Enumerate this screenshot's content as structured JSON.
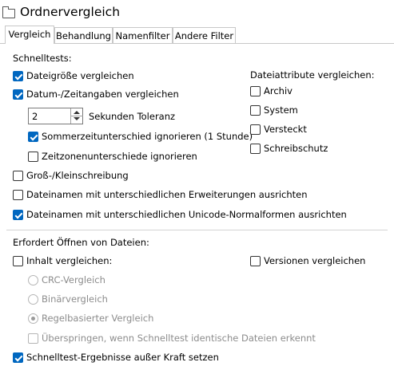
{
  "window": {
    "title": "Ordnervergleich",
    "icon": "folder-icon"
  },
  "tabs": [
    {
      "label": "Vergleich",
      "active": true
    },
    {
      "label": "Behandlung"
    },
    {
      "label": "Namenfilter"
    },
    {
      "label": "Andere Filter"
    }
  ],
  "quick": {
    "heading": "Schnelltests:",
    "size": "Dateigröße vergleichen",
    "datetime": "Datum-/Zeitangaben vergleichen",
    "tolerance_value": "2",
    "tolerance_label": "Sekunden Toleranz",
    "dst": "Sommerzeitunterschied ignorieren (1 Stunde)",
    "timezone": "Zeitzonenunterschiede ignorieren",
    "case": "Groß-/Kleinschreibung",
    "extensions": "Dateinamen mit unterschiedlichen Erweiterungen ausrichten",
    "unicode": "Dateinamen mit unterschiedlichen Unicode-Normalformen ausrichten"
  },
  "attributes": {
    "heading": "Dateiattribute vergleichen:",
    "archive": "Archiv",
    "system": "System",
    "hidden": "Versteckt",
    "readonly": "Schreibschutz"
  },
  "open": {
    "heading": "Erfordert Öffnen von Dateien:",
    "content": "Inhalt vergleichen:",
    "versions": "Versionen vergleichen",
    "crc": "CRC-Vergleich",
    "binary": "Binärvergleich",
    "rules": "Regelbasierter Vergleich",
    "skip": "Überspringen, wenn Schnelltest identische Dateien erkennt",
    "override": "Schnelltest-Ergebnisse außer Kraft setzen"
  }
}
